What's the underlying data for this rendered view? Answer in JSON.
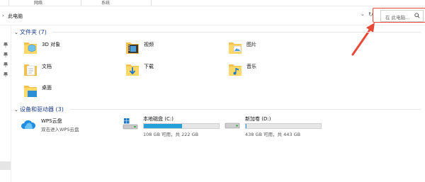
{
  "ribbon": {
    "tabs": [
      {
        "label": "网络"
      },
      {
        "label": "系统"
      }
    ]
  },
  "address": {
    "path": "此电脑",
    "search_placeholder": "在 此电脑..."
  },
  "sections": {
    "folders": {
      "title": "文件夹 (7)"
    },
    "drives": {
      "title": "设备和驱动器 (3)"
    }
  },
  "folders": [
    {
      "label": "3D 对象",
      "icon": "3d-objects-folder-icon"
    },
    {
      "label": "视频",
      "icon": "videos-folder-icon"
    },
    {
      "label": "图片",
      "icon": "pictures-folder-icon"
    },
    {
      "label": "文档",
      "icon": "documents-folder-icon"
    },
    {
      "label": "下载",
      "icon": "downloads-folder-icon"
    },
    {
      "label": "音乐",
      "icon": "music-folder-icon"
    },
    {
      "label": "桌面",
      "icon": "desktop-folder-icon"
    }
  ],
  "drives": [
    {
      "name": "WPS云盘",
      "sub": "双击进入WPS云盘",
      "icon": "wps-cloud-icon"
    },
    {
      "name": "本地磁盘 (C:)",
      "sub": "108 GB 可用，共 222 GB",
      "used_fraction": 0.51,
      "icon": "windows-drive-icon"
    },
    {
      "name": "新加卷 (D:)",
      "sub": "438 GB 可用，共 443 GB",
      "used_fraction": 0.012,
      "icon": "drive-icon"
    }
  ],
  "colors": {
    "accent": "#26a0da",
    "highlight": "#e84a3a",
    "folder": "#f4c04e"
  }
}
